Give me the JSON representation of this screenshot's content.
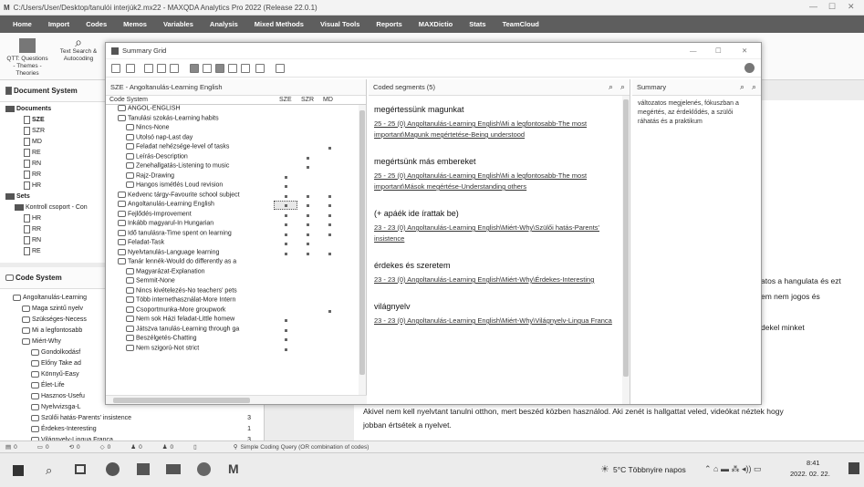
{
  "app": {
    "title": "C:/Users/User/Desktop/tanulói interjúk2.mx22 - MAXQDA Analytics Pro 2022 (Release 22.0.1)"
  },
  "ribbon_tabs": [
    {
      "label": "Home"
    },
    {
      "label": "Import"
    },
    {
      "label": "Codes"
    },
    {
      "label": "Memos"
    },
    {
      "label": "Variables"
    },
    {
      "label": "Analysis"
    },
    {
      "label": "Mixed Methods"
    },
    {
      "label": "Visual Tools"
    },
    {
      "label": "Reports"
    },
    {
      "label": "MAXDictio"
    },
    {
      "label": "Stats"
    },
    {
      "label": "TeamCloud"
    }
  ],
  "ribbon": {
    "qtt_label": "QTT: Questions - Themes - Theories",
    "text_search_label": "Text Search & Autocoding"
  },
  "document_system": {
    "title": "Document System",
    "items": [
      "Documents",
      "SZE",
      "SZR",
      "MD",
      "RE",
      "RN",
      "RR",
      "HR",
      "Sets",
      "Kontroll csoport - Con",
      "HR",
      "RR",
      "RN",
      "RE"
    ]
  },
  "code_system": {
    "title": "Code System",
    "items": [
      {
        "label": "Angoltanulás-Learning",
        "count": ""
      },
      {
        "label": "Maga szintű nyelv",
        "count": ""
      },
      {
        "label": "Szükséges-Necess",
        "count": ""
      },
      {
        "label": "Mi a legfontosabb",
        "count": ""
      },
      {
        "label": "Miért-Why",
        "count": ""
      },
      {
        "label": "Gondolkodásf",
        "count": ""
      },
      {
        "label": "Előny Take ad",
        "count": ""
      },
      {
        "label": "Könnyű-Easy",
        "count": ""
      },
      {
        "label": "Élet-Life",
        "count": ""
      },
      {
        "label": "Hasznos-Usefu",
        "count": ""
      },
      {
        "label": "Nyelvvizsga-L",
        "count": ""
      },
      {
        "label": "Szülői hatás-Parents' insistence",
        "count": "3"
      },
      {
        "label": "Érdekes-Interesting",
        "count": "1"
      },
      {
        "label": "Világnyelv-Lingua Franca",
        "count": "3"
      }
    ]
  },
  "dialog": {
    "title": "Summary Grid",
    "left_header": "SZE - Angoltanulás-Learning English",
    "grid_columns": [
      "Code System",
      "SZE",
      "SZR",
      "MD"
    ],
    "rows": [
      {
        "label": "ANGOL-ENGLISH",
        "indent": 1,
        "dots": []
      },
      {
        "label": "Tanulási szokás-Learning habits",
        "indent": 1,
        "dots": []
      },
      {
        "label": "Nincs-None",
        "indent": 2,
        "dots": []
      },
      {
        "label": "Utolsó nap-Last day",
        "indent": 2,
        "dots": []
      },
      {
        "label": "Feladat nehézsége-level of tasks",
        "indent": 2,
        "dots": [
          3
        ]
      },
      {
        "label": "Leírás-Description",
        "indent": 2,
        "dots": [
          2
        ]
      },
      {
        "label": "Zenehallgatás-Listening to music",
        "indent": 2,
        "dots": [
          2
        ]
      },
      {
        "label": "Rajz-Drawing",
        "indent": 2,
        "dots": [
          1
        ]
      },
      {
        "label": "Hangos ismétlés Loud revision",
        "indent": 2,
        "dots": [
          1
        ]
      },
      {
        "label": "Kedvenc tárgy-Favourite school subject",
        "indent": 1,
        "dots": [
          1,
          2,
          3
        ]
      },
      {
        "label": "Angoltanulás-Learning English",
        "indent": 1,
        "dots": [
          1,
          2,
          3
        ]
      },
      {
        "label": "Fejlődés-Improvement",
        "indent": 1,
        "dots": [
          1,
          2,
          3
        ]
      },
      {
        "label": "Inkább magyarul-In Hungarian",
        "indent": 1,
        "dots": [
          1,
          2,
          3
        ]
      },
      {
        "label": "Idő tanulásra-Time spent on learning",
        "indent": 1,
        "dots": [
          1,
          2,
          3
        ]
      },
      {
        "label": "Feladat-Task",
        "indent": 1,
        "dots": [
          1,
          2
        ]
      },
      {
        "label": "Nyelvtanulás-Language learning",
        "indent": 1,
        "dots": [
          1,
          2,
          3
        ]
      },
      {
        "label": "Tanár lennék-Would do differently as a",
        "indent": 1,
        "dots": []
      },
      {
        "label": "Magyarázat-Explanation",
        "indent": 2,
        "dots": []
      },
      {
        "label": "Semmit-None",
        "indent": 2,
        "dots": []
      },
      {
        "label": "Nincs kivételezés-No teachers' pets",
        "indent": 2,
        "dots": []
      },
      {
        "label": "Több internethasználat-More Intern",
        "indent": 2,
        "dots": []
      },
      {
        "label": "Csoportmunka-More groupwork",
        "indent": 2,
        "dots": [
          3
        ]
      },
      {
        "label": "Nem sok Házi feladat-Little homew",
        "indent": 2,
        "dots": [
          1
        ]
      },
      {
        "label": "Játszva tanulás-Learning through ga",
        "indent": 2,
        "dots": [
          1
        ]
      },
      {
        "label": "Beszélgetés-Chatting",
        "indent": 2,
        "dots": [
          1
        ]
      },
      {
        "label": "Nem szigorú-Not strict",
        "indent": 2,
        "dots": [
          1
        ]
      }
    ],
    "mid_header": "Coded segments (5)",
    "segments": [
      {
        "title": "megértessünk magunkat",
        "ref": "25 - 25  (0) Angoltanulás-Learning English\\Mi a legfontosabb-The most important\\Magunk megértetése-Being understood"
      },
      {
        "title": "megértsünk más embereket",
        "ref": "25 - 25  (0) Angoltanulás-Learning English\\Mi a legfontosabb-The most important\\Mások megértése-Understanding others"
      },
      {
        "title": "(+ apáék ide írattak be)",
        "ref": "23 - 23  (0) Angoltanulás-Learning English\\Miért-Why\\Szülői hatás-Parents' insistence"
      },
      {
        "title": "érdekes és szeretem",
        "ref": "23 - 23  (0) Angoltanulás-Learning English\\Miért-Why\\Érdekes-Interesting"
      },
      {
        "title": "világnyelv",
        "ref": "23 - 23  (0) Angoltanulás-Learning English\\Miért-Why\\Világnyelv-Lingua Franca"
      }
    ],
    "right_header": "Summary",
    "summary_text": "változatos megjelenés, fókuszban a megértés, az érdeklődés, a szülői ráhatás és a praktikum"
  },
  "document_browser": {
    "right_lines": [
      "atos a hangulata és ezt",
      "em nem jogos és",
      "",
      "dekel minket"
    ],
    "bottom_line1": "Akivel nem kell nyelvtant tanulni otthon, mert beszéd közben használod. Aki zenét is hallgattat veled, videókat néztek hogy",
    "bottom_line2": "jobban értsétek a nyelvet."
  },
  "status_bar": {
    "c1": "0",
    "c2": "0",
    "c3": "0",
    "c4": "0",
    "c5": "0",
    "c6": "0",
    "query": "Simple Coding Query (OR combination of codes)"
  },
  "taskbar": {
    "weather": "5°C  Többnyire napos",
    "time": "8:41",
    "date": "2022. 02. 22."
  }
}
